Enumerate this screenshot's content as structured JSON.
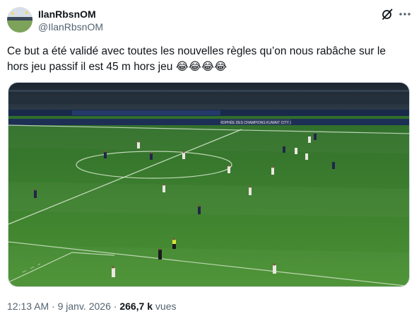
{
  "author": {
    "display_name": "IlanRbsnOM",
    "handle": "@IlanRbsnOM",
    "avatar_icon": "avatar-stadium"
  },
  "actions": {
    "grok_icon": "grok-icon",
    "more_icon": "more-dots-icon"
  },
  "tweet": {
    "text": "Ce but a été validé avec toutes les nouvelles règles qu’on nous rabâche sur le hors jeu passif il est 45 m hors jeu 😂😂😂😂"
  },
  "media": {
    "type": "image",
    "description_icon": "football-pitch-image",
    "boards_text": "TROPHÉE DES CHAMPIONS KUWAIT CITY 25"
  },
  "meta": {
    "time": "12:13 AM",
    "separator": "·",
    "date": "9 janv. 2026",
    "views_count": "266,7 k",
    "views_label": "vues"
  },
  "colors": {
    "text_primary": "#0f1419",
    "text_secondary": "#536471",
    "border": "#cfd9de",
    "pitch": "#3f8a2e"
  }
}
